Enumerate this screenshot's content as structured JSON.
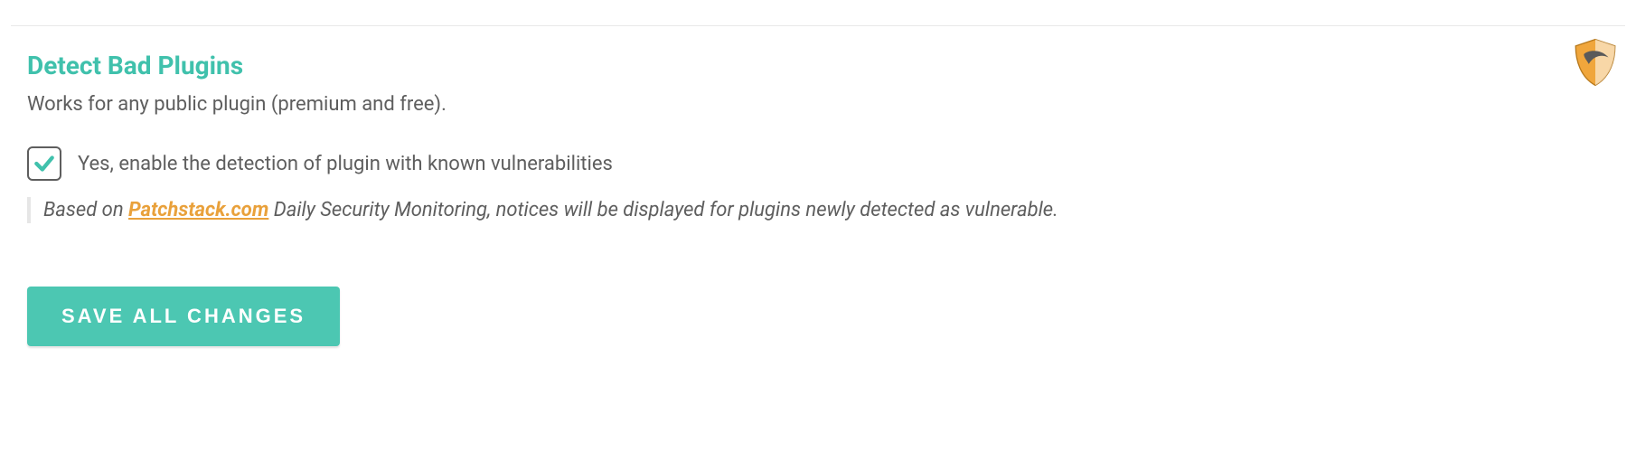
{
  "section": {
    "title": "Detect Bad Plugins",
    "description": "Works for any public plugin (premium and free)."
  },
  "checkbox": {
    "checked": true,
    "label": "Yes, enable the detection of plugin with known vulnerabilities"
  },
  "note": {
    "prefix": "Based on ",
    "link_text": "Patchstack.com",
    "suffix": " Daily Security Monitoring, notices will be displayed for plugins newly detected as vulnerable."
  },
  "buttons": {
    "save": "SAVE ALL CHANGES"
  },
  "colors": {
    "accent": "#40c1ac",
    "link": "#e9a13b"
  }
}
